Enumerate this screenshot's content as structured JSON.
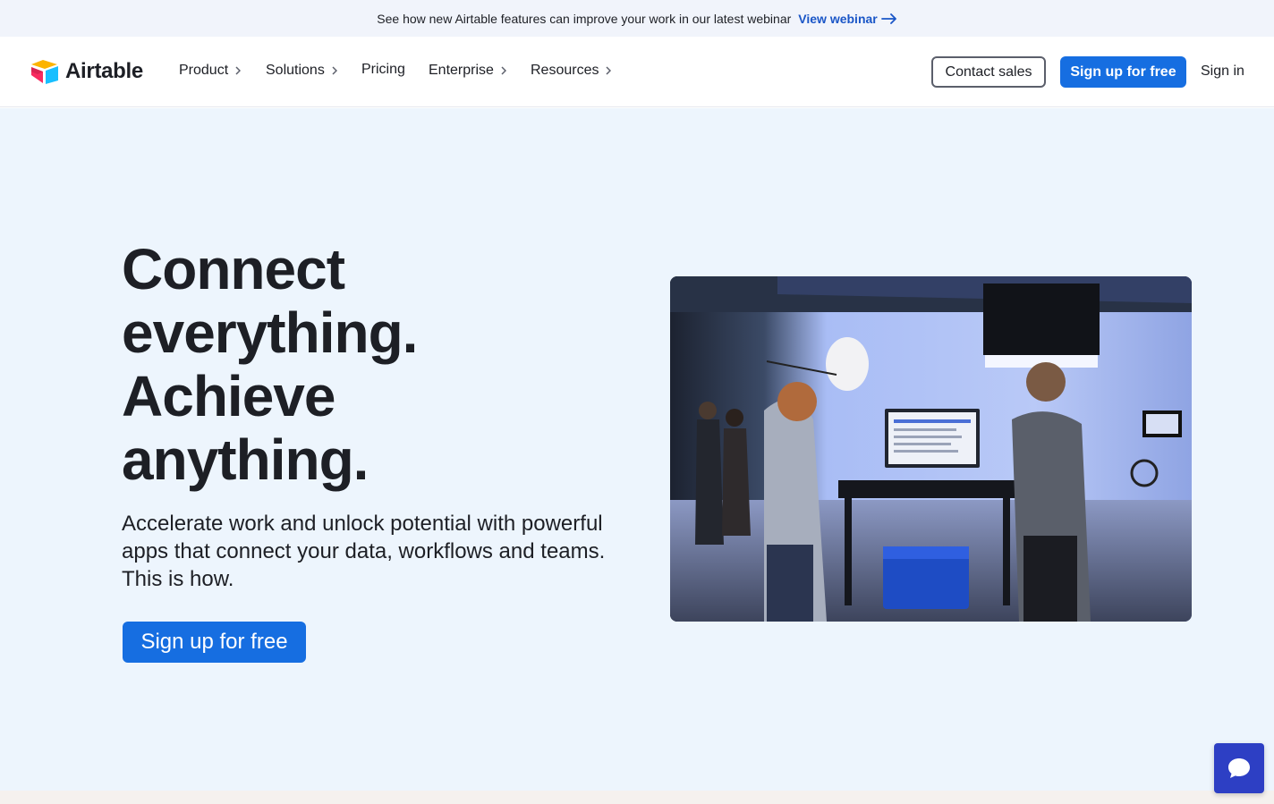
{
  "banner": {
    "text": "See how new Airtable features can improve your work in our latest webinar",
    "link_label": "View webinar"
  },
  "nav": {
    "logo_text": "Airtable",
    "items": [
      {
        "label": "Product",
        "has_chevron": true
      },
      {
        "label": "Solutions",
        "has_chevron": true
      },
      {
        "label": "Pricing",
        "has_chevron": false
      },
      {
        "label": "Enterprise",
        "has_chevron": true
      },
      {
        "label": "Resources",
        "has_chevron": true
      }
    ],
    "contact_sales": "Contact sales",
    "signup": "Sign up for free",
    "signin": "Sign in"
  },
  "hero": {
    "headline_lines": [
      "Connect",
      "everything.",
      "Achieve",
      "anything."
    ],
    "subtitle": "Accelerate work and unlock potential with powerful apps that connect your data, workflows and teams. This is how.",
    "cta": "Sign up for free"
  },
  "colors": {
    "accent": "#166ee1",
    "hero_bg": "#edf5fd",
    "banner_bg": "#f1f4fb",
    "chat": "#2d3fc4"
  },
  "icons": {
    "chat": "chat-bubble-icon",
    "arrow": "arrow-right-icon",
    "chevron": "chevron-right-icon"
  }
}
